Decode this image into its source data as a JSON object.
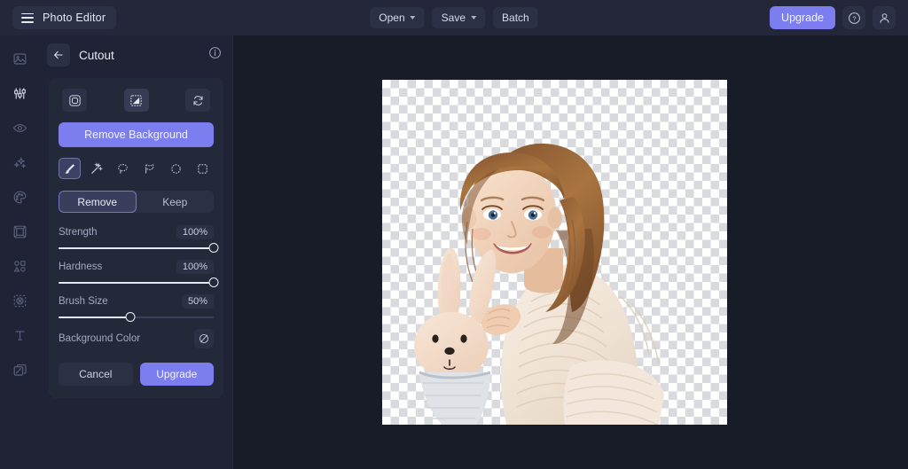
{
  "app": {
    "name": "Photo Editor",
    "menu_icon": "hamburger-icon",
    "background": "#181b28",
    "accent": "#7c7ef0"
  },
  "topbar": {
    "buttons": [
      {
        "label": "Open",
        "has_caret": true
      },
      {
        "label": "Save",
        "has_caret": true
      },
      {
        "label": "Batch",
        "has_caret": false
      }
    ],
    "upgrade_label": "Upgrade",
    "help_icon": "question-mark-circle-icon",
    "account_icon": "user-avatar-icon"
  },
  "sidebar": {
    "items": [
      {
        "name": "image",
        "icon": "image-icon",
        "active": false
      },
      {
        "name": "adjust",
        "icon": "sliders-icon",
        "active": true
      },
      {
        "name": "retouch",
        "icon": "eye-icon",
        "active": false
      },
      {
        "name": "effects",
        "icon": "sparkles-icon",
        "active": false
      },
      {
        "name": "color",
        "icon": "palette-icon",
        "active": false
      },
      {
        "name": "frame",
        "icon": "frame-icon",
        "active": false
      },
      {
        "name": "shapes",
        "icon": "shapes-icon",
        "active": false
      },
      {
        "name": "cutout",
        "icon": "cutout-icon",
        "active": false
      },
      {
        "name": "text",
        "icon": "text-t-icon",
        "active": false
      },
      {
        "name": "layers",
        "icon": "layers-icon",
        "active": false
      }
    ]
  },
  "panel": {
    "back_icon": "arrow-left-icon",
    "title": "Cutout",
    "info_icon": "info-circle-icon",
    "view_modes": [
      {
        "name": "original",
        "icon": "original-image-icon",
        "active": false
      },
      {
        "name": "mask",
        "icon": "transparency-mask-icon",
        "active": true
      },
      {
        "name": "reset",
        "icon": "refresh-icon",
        "active": false
      }
    ],
    "remove_background_label": "Remove Background",
    "tools": [
      {
        "name": "brush",
        "icon": "brush-icon",
        "active": true
      },
      {
        "name": "magic-wand",
        "icon": "magic-wand-icon",
        "active": false
      },
      {
        "name": "lasso",
        "icon": "lasso-icon",
        "active": false
      },
      {
        "name": "polygon-lasso",
        "icon": "polygon-lasso-icon",
        "active": false
      },
      {
        "name": "ellipse-select",
        "icon": "ellipse-marquee-icon",
        "active": false
      },
      {
        "name": "rect-select",
        "icon": "rect-marquee-icon",
        "active": false
      }
    ],
    "segments": [
      {
        "label": "Remove",
        "active": true
      },
      {
        "label": "Keep",
        "active": false
      }
    ],
    "sliders": [
      {
        "label": "Strength",
        "value": "100%",
        "percent": 100
      },
      {
        "label": "Hardness",
        "value": "100%",
        "percent": 100
      },
      {
        "label": "Brush Size",
        "value": "50%",
        "percent": 50
      }
    ],
    "background_color": {
      "label": "Background Color",
      "swatch_icon": "no-color-transparent-icon"
    },
    "cancel_label": "Cancel",
    "upgrade_label": "Upgrade"
  },
  "canvas": {
    "name": "cutout-canvas",
    "background": "transparent-checkerboard",
    "subject_description": "Young child with brown hair wearing a cream knit sweater, holding a plush bunny toy"
  }
}
